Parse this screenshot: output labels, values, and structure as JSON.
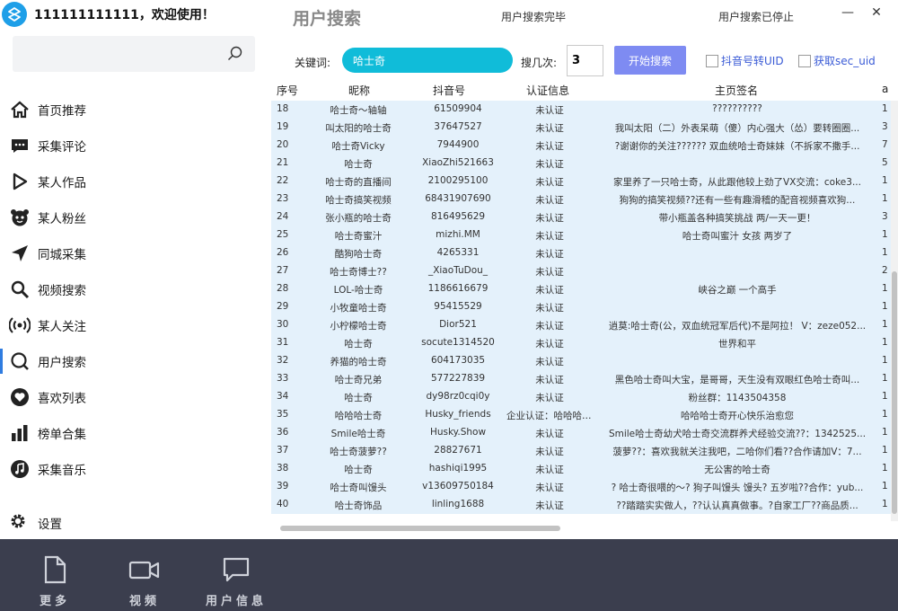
{
  "user": {
    "name": "111111111111，欢迎使用！"
  },
  "sidebar": {
    "items": [
      {
        "label": "首页推荐",
        "icon": "home-icon"
      },
      {
        "label": "采集评论",
        "icon": "comment-icon"
      },
      {
        "label": "某人作品",
        "icon": "play-icon"
      },
      {
        "label": "某人粉丝",
        "icon": "fans-icon"
      },
      {
        "label": "同城采集",
        "icon": "location-icon"
      },
      {
        "label": "视频搜索",
        "icon": "search-icon"
      },
      {
        "label": "某人关注",
        "icon": "broadcast-icon"
      },
      {
        "label": "用户搜索",
        "icon": "user-search-icon"
      },
      {
        "label": "喜欢列表",
        "icon": "heart-icon"
      },
      {
        "label": "榜单合集",
        "icon": "bar-chart-icon"
      },
      {
        "label": "采集音乐",
        "icon": "music-icon"
      }
    ],
    "settings_label": "设置"
  },
  "bottom": {
    "more_label": "更多",
    "video_label": "视频",
    "user_info_label": "用户信息"
  },
  "header": {
    "title": "用户搜索",
    "status_left": "用户搜索完毕",
    "status_right": "用户搜索已停止",
    "min_glyph": "—",
    "close_glyph": "✕"
  },
  "search": {
    "keyword_label": "关键词:",
    "keyword_value": "哈士奇",
    "times_label": "搜几次:",
    "times_value": "3",
    "start_label": "开始搜索",
    "option1_label": "抖音号转UID",
    "option2_label": "获取sec_uid"
  },
  "table": {
    "headers": [
      "序号",
      "昵称",
      "抖音号",
      "认证信息",
      "主页签名",
      "a"
    ],
    "rows": [
      [
        "18",
        "哈士奇～轴轴",
        "61509904",
        "未认证",
        "??????????",
        "1"
      ],
      [
        "19",
        "叫太阳的哈士奇",
        "37647527",
        "未认证",
        "我叫太阳（二）外表呆萌（傻）内心强大（怂）要转圈圈...",
        "3"
      ],
      [
        "20",
        "哈士奇Vicky",
        "7944900",
        "未认证",
        "?谢谢你的关注?????? 双血统哈士奇妹妹（不拆家不撒手...",
        "7"
      ],
      [
        "21",
        "哈士奇",
        "XiaoZhi521663",
        "未认证",
        "",
        "5"
      ],
      [
        "22",
        "哈士奇的直播间",
        "2100295100",
        "未认证",
        "家里养了一只哈士奇，从此跟他较上劲了VX交流：coke3...",
        "1"
      ],
      [
        "23",
        "哈士奇搞笑视频",
        "68431907690",
        "未认证",
        "狗狗的搞笑视频??还有一些有趣滑稽的配音视频喜欢狗...",
        "1"
      ],
      [
        "24",
        "张小瓶的哈士奇",
        "816495629",
        "未认证",
        "带小瓶盖各种搞笑挑战 两/一天一更！",
        "3"
      ],
      [
        "25",
        "哈士奇蜜汁",
        "mizhi.MM",
        "未认证",
        "哈士奇叫蜜汁 女孩 两岁了",
        "1"
      ],
      [
        "26",
        "酷狗哈士奇",
        "4265331",
        "未认证",
        "",
        "1"
      ],
      [
        "27",
        "哈士奇博士??",
        "_XiaoTuDou_",
        "未认证",
        "",
        "2"
      ],
      [
        "28",
        "LOL-哈士奇",
        "1186616679",
        "未认证",
        "峡谷之巅 一个高手",
        "1"
      ],
      [
        "29",
        "小牧童哈士奇",
        "95415529",
        "未认证",
        "",
        "1"
      ],
      [
        "30",
        "小柠檬哈士奇",
        "Dior521",
        "未认证",
        "逍莫:哈士奇(公，双血统冠军后代)不是阿拉！ V：zeze052...",
        "1"
      ],
      [
        "31",
        "哈士奇",
        "socute1314520",
        "未认证",
        "世界和平",
        "1"
      ],
      [
        "32",
        "养猫的哈士奇",
        "604173035",
        "未认证",
        "",
        "1"
      ],
      [
        "33",
        "哈士奇兄弟",
        "577227839",
        "未认证",
        "黑色哈士奇叫大宝，是哥哥，天生没有双眼红色哈士奇叫...",
        "1"
      ],
      [
        "34",
        "哈士奇",
        "dy98rz0cqi0y",
        "未认证",
        "粉丝群：1143504358",
        "1"
      ],
      [
        "35",
        "哈哈哈士奇",
        "Husky_friends",
        "企业认证：哈哈哈士...",
        "哈哈哈士奇开心快乐治愈您",
        "1"
      ],
      [
        "36",
        "Smile哈士奇",
        "Husky.Show",
        "未认证",
        "Smile哈士奇幼犬哈士奇交流群养犬经验交流??：1342525...",
        "1"
      ],
      [
        "37",
        "哈士奇菠萝??",
        "28827671",
        "未认证",
        "菠萝??：喜欢我就关注我吧，二哈你们看??合作请加V：7...",
        "1"
      ],
      [
        "38",
        "哈士奇",
        "hashiqi1995",
        "未认证",
        "无公害的哈士奇",
        "1"
      ],
      [
        "39",
        "哈士奇叫馒头",
        "v13609750184",
        "未认证",
        "? 哈士奇很喂的～? 狗子叫馒头 馒头? 五岁啦??合作：yub...",
        "1"
      ],
      [
        "40",
        "哈士奇饰品",
        "linling1688",
        "未认证",
        "??踏踏实实做人，??认认真真做事。?自家工厂??商品质...",
        "1"
      ]
    ]
  },
  "colors": {
    "accent": "#2f7ce0",
    "keyword_bg": "#10bcd9",
    "start_btn": "#7e8bf2",
    "row_bg": "#e4f1fb",
    "bottom_bar": "#3b3e4e"
  }
}
